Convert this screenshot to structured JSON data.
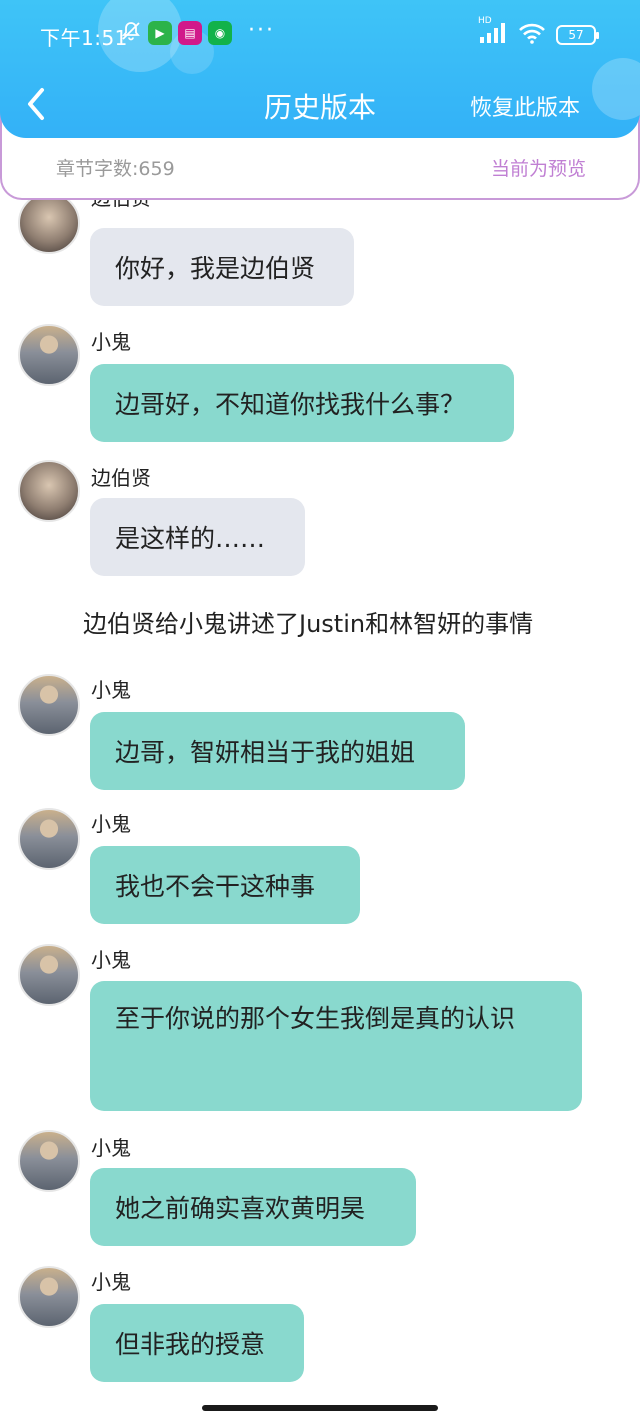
{
  "status_bar": {
    "time": "下午1:51",
    "more": "···",
    "battery": "57",
    "hd": "HD"
  },
  "header": {
    "title": "历史版本",
    "restore_label": "恢复此版本"
  },
  "info": {
    "word_count": "章节字数:659",
    "preview_status": "当前为预览"
  },
  "messages": [
    {
      "sender": "边伯贤",
      "text": "你好，我是边伯贤"
    },
    {
      "sender": "小鬼",
      "text": "边哥好，不知道你找我什么事？"
    },
    {
      "sender": "边伯贤",
      "text": "是这样的……"
    },
    {
      "narration": "边伯贤给小鬼讲述了Justin和林智妍的事情"
    },
    {
      "sender": "小鬼",
      "text": "边哥，智妍相当于我的姐姐"
    },
    {
      "sender": "小鬼",
      "text": "我也不会干这种事"
    },
    {
      "sender": "小鬼",
      "text": "至于你说的那个女生我倒是真的认识"
    },
    {
      "sender": "小鬼",
      "text": "她之前确实喜欢黄明昊"
    },
    {
      "sender": "小鬼",
      "text": "但非我的授意"
    }
  ],
  "colors": {
    "header": "#33b1f7",
    "bubble_gray": "#e4e7ee",
    "bubble_teal": "#89d9ce",
    "preview_purple": "#c07fd3"
  }
}
